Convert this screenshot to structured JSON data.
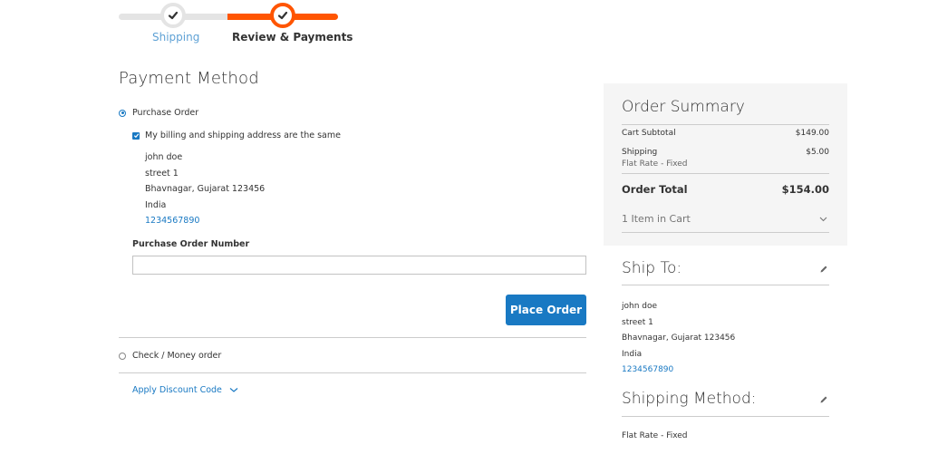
{
  "progress": {
    "steps": [
      {
        "label": "Shipping",
        "state": "complete"
      },
      {
        "label": "Review & Payments",
        "state": "active"
      }
    ],
    "colors": {
      "active": "#ff5501",
      "inactive": "#e4e4e4",
      "link": "#1979c3"
    }
  },
  "payment": {
    "title": "Payment Method",
    "methods": [
      {
        "label": "Purchase Order",
        "selected": true
      },
      {
        "label": "Check / Money order",
        "selected": false
      }
    ],
    "same_address_label": "My billing and shipping address are the same",
    "same_address_checked": true,
    "billing_address": {
      "name": "john doe",
      "street": "street 1",
      "city_region_zip": "Bhavnagar, Gujarat 123456",
      "country": "India",
      "phone": "1234567890"
    },
    "po_number_label": "Purchase Order Number",
    "po_number_value": "",
    "place_order_label": "Place Order",
    "discount_label": "Apply Discount Code"
  },
  "summary": {
    "title": "Order Summary",
    "cart_subtotal_label": "Cart Subtotal",
    "cart_subtotal_value": "$149.00",
    "shipping_label": "Shipping",
    "shipping_method": "Flat Rate - Fixed",
    "shipping_value": "$5.00",
    "order_total_label": "Order Total",
    "order_total_value": "$154.00",
    "items_in_cart": "1 Item in Cart"
  },
  "ship_to": {
    "title": "Ship To:",
    "name": "john doe",
    "street": "street 1",
    "city_region_zip": "Bhavnagar, Gujarat 123456",
    "country": "India",
    "phone": "1234567890"
  },
  "shipping_method": {
    "title": "Shipping Method:",
    "value": "Flat Rate - Fixed"
  }
}
